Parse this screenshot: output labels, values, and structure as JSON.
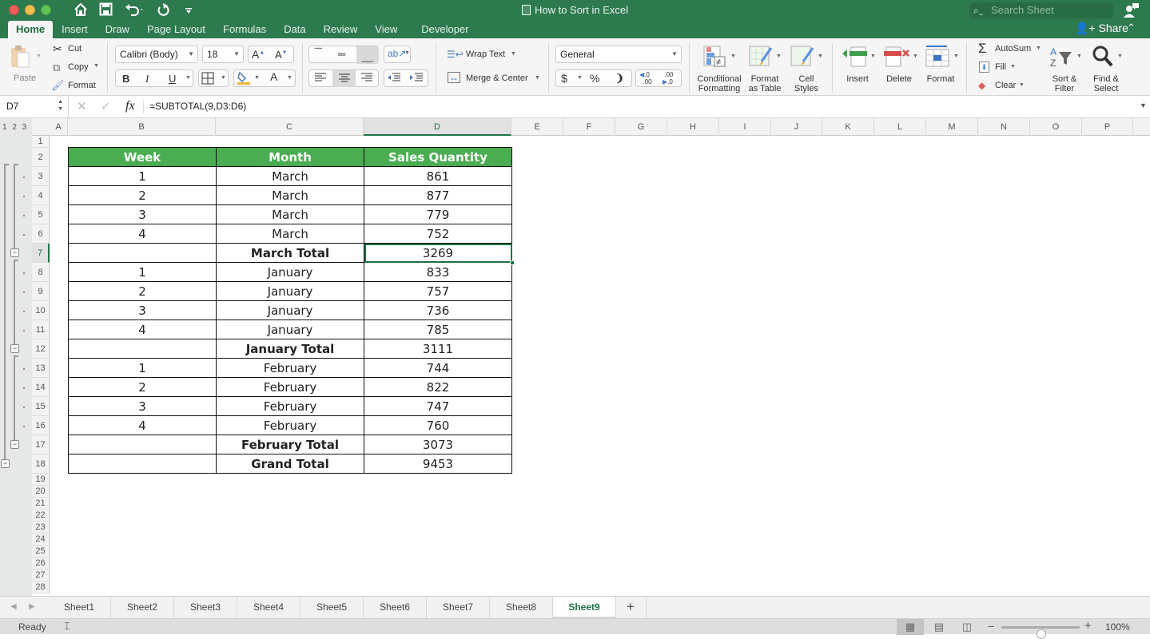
{
  "window": {
    "title": "How to Sort in Excel",
    "search_placeholder": "Search Sheet",
    "share_label": "Share"
  },
  "quick_access": {
    "home_icon": "⌂",
    "save_icon": "💾",
    "undo_icon": "↶",
    "redo_icon": "↻",
    "customize_icon": "⌄"
  },
  "ribbon_tabs": [
    {
      "label": "Home",
      "active": true
    },
    {
      "label": "Insert"
    },
    {
      "label": "Draw"
    },
    {
      "label": "Page Layout"
    },
    {
      "label": "Formulas"
    },
    {
      "label": "Data"
    },
    {
      "label": "Review"
    },
    {
      "label": "View"
    },
    {
      "label": "Developer"
    }
  ],
  "ribbon": {
    "clipboard": {
      "paste": "Paste",
      "cut": "Cut",
      "copy": "Copy",
      "format": "Format"
    },
    "font": {
      "name": "Calibri (Body)",
      "size": "18",
      "bold": "B",
      "italic": "I",
      "underline": "U",
      "grow": "A",
      "shrink": "A",
      "font_color": "A"
    },
    "alignment": {
      "wrap_text": "Wrap Text",
      "merge_center": "Merge & Center"
    },
    "number": {
      "format": "General",
      "currency": "$",
      "percent": "%",
      "comma": "❩",
      "inc_decimal": ".00",
      "dec_decimal": ".0"
    },
    "styles": {
      "conditional": [
        "Conditional",
        "Formatting"
      ],
      "format_table": [
        "Format",
        "as Table"
      ],
      "cell_styles": [
        "Cell",
        "Styles"
      ]
    },
    "cells": {
      "insert": "Insert",
      "delete": "Delete",
      "format": "Format"
    },
    "editing": {
      "autosum": "AutoSum",
      "fill": "Fill",
      "clear": "Clear",
      "sort_filter": [
        "Sort &",
        "Filter"
      ],
      "find_select": [
        "Find &",
        "Select"
      ]
    }
  },
  "formula_bar": {
    "name_box": "D7",
    "formula": "=SUBTOTAL(9,D3:D6)",
    "fx_label": "fx"
  },
  "outline": {
    "levels": "1 2 3"
  },
  "columns": [
    "A",
    "B",
    "C",
    "D",
    "E",
    "F",
    "G",
    "H",
    "I",
    "J",
    "K",
    "L",
    "M",
    "N",
    "O",
    "P"
  ],
  "selected_cell": {
    "column": "D",
    "row": 7
  },
  "rows": [
    "1",
    "2",
    "3",
    "4",
    "5",
    "6",
    "7",
    "8",
    "9",
    "10",
    "11",
    "12",
    "13",
    "14",
    "15",
    "16",
    "17",
    "18",
    "19",
    "20",
    "21",
    "22",
    "23",
    "24",
    "25",
    "26",
    "27",
    "28"
  ],
  "table": {
    "headers": [
      "Week",
      "Month",
      "Sales Quantity"
    ],
    "rows": [
      {
        "week": "1",
        "month": "March",
        "qty": "861"
      },
      {
        "week": "2",
        "month": "March",
        "qty": "877"
      },
      {
        "week": "3",
        "month": "March",
        "qty": "779"
      },
      {
        "week": "4",
        "month": "March",
        "qty": "752"
      },
      {
        "week": "",
        "month": "March Total",
        "qty": "3269",
        "total": true,
        "selected": true
      },
      {
        "week": "1",
        "month": "January",
        "qty": "833"
      },
      {
        "week": "2",
        "month": "January",
        "qty": "757"
      },
      {
        "week": "3",
        "month": "January",
        "qty": "736"
      },
      {
        "week": "4",
        "month": "January",
        "qty": "785"
      },
      {
        "week": "",
        "month": "January Total",
        "qty": "3111",
        "total": true
      },
      {
        "week": "1",
        "month": "February",
        "qty": "744"
      },
      {
        "week": "2",
        "month": "February",
        "qty": "822"
      },
      {
        "week": "3",
        "month": "February",
        "qty": "747"
      },
      {
        "week": "4",
        "month": "February",
        "qty": "760"
      },
      {
        "week": "",
        "month": "February Total",
        "qty": "3073",
        "total": true
      },
      {
        "week": "",
        "month": "Grand Total",
        "qty": "9453",
        "total": true
      }
    ]
  },
  "sheet_tabs": [
    {
      "label": "Sheet1"
    },
    {
      "label": "Sheet2"
    },
    {
      "label": "Sheet3"
    },
    {
      "label": "Sheet4"
    },
    {
      "label": "Sheet5"
    },
    {
      "label": "Sheet6"
    },
    {
      "label": "Sheet7"
    },
    {
      "label": "Sheet8"
    },
    {
      "label": "Sheet9",
      "active": true
    }
  ],
  "add_sheet": "+",
  "status": {
    "ready": "Ready",
    "zoom": "100%",
    "zoom_percent": 100
  },
  "colors": {
    "title_green": "#2e7a4f",
    "header_fill": "#4aad52",
    "selection": "#217346"
  }
}
